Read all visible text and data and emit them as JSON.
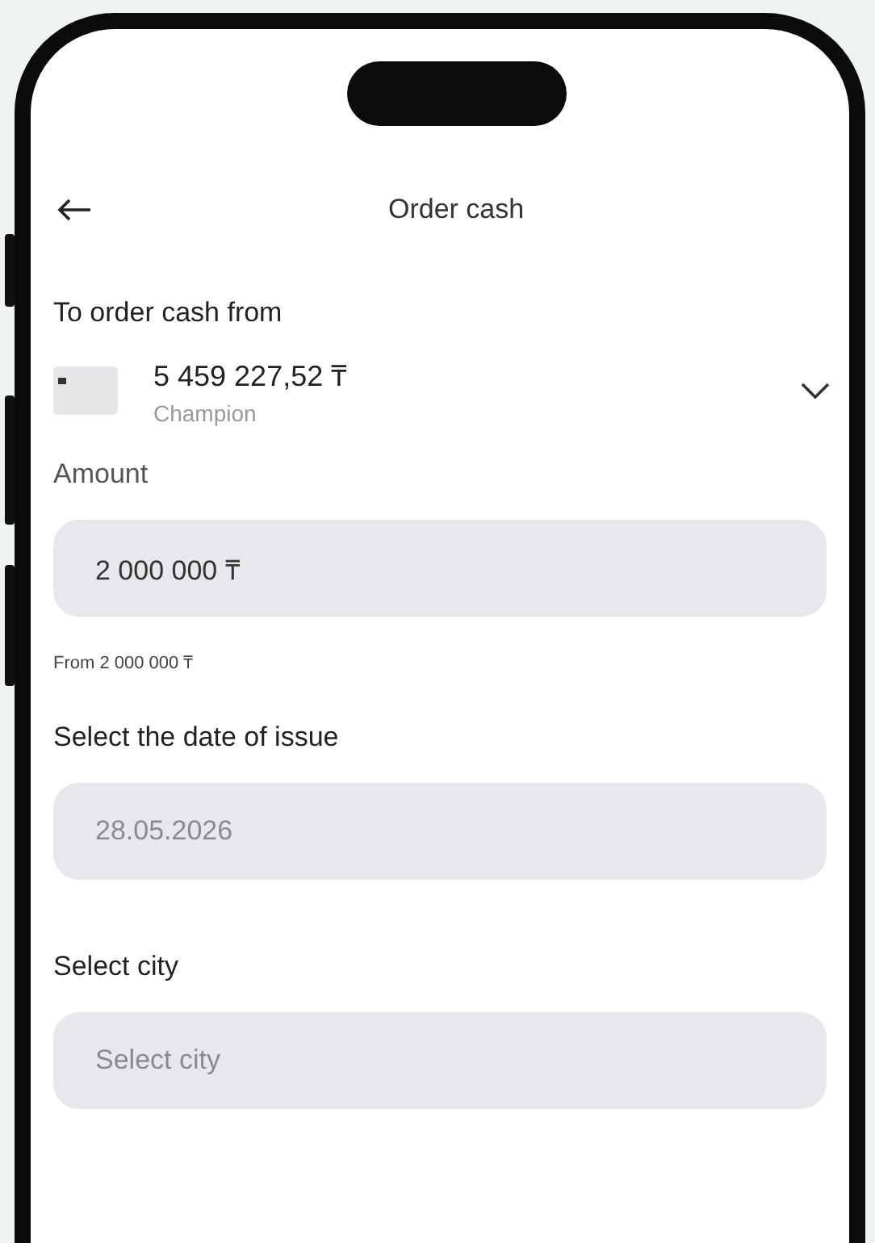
{
  "header": {
    "title": "Order cash"
  },
  "source": {
    "label": "To order cash from",
    "balance": "5 459 227,52 ₸",
    "account_name": "Champion"
  },
  "fields": [
    {
      "label": "Amount",
      "value": "2 000 000 ₸",
      "hint": "From 2 000 000 ₸"
    },
    {
      "label": "Select the date of issue",
      "placeholder": "28.05.2026"
    },
    {
      "label": "Select city",
      "placeholder": "Select city"
    }
  ]
}
